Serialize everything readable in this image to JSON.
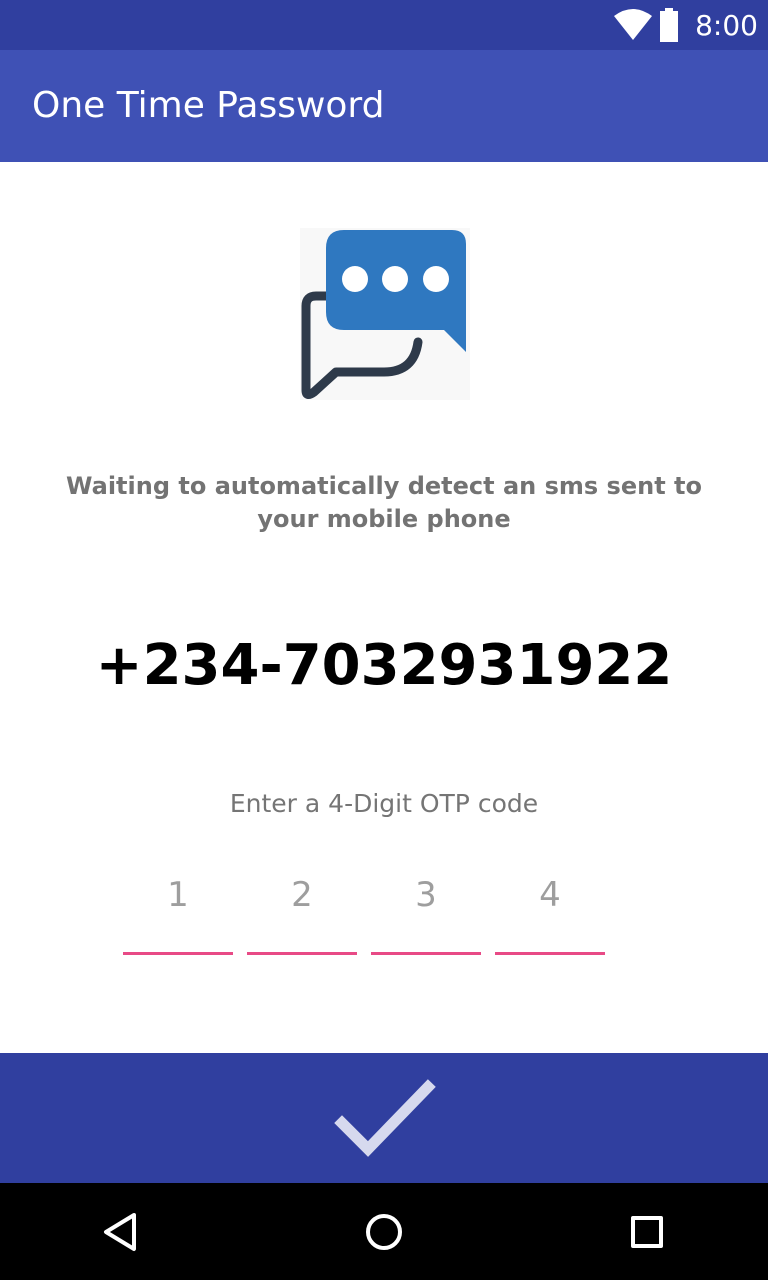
{
  "status_bar": {
    "time": "8:00",
    "icons": [
      "wifi-icon",
      "battery-icon"
    ],
    "background": "#303f9f"
  },
  "app_bar": {
    "title": "One Time Password",
    "background": "#3f51b5"
  },
  "main": {
    "illustration_icon": "chat-bubbles-icon",
    "waiting_text": "Waiting to automatically detect an sms sent to your mobile phone",
    "phone_number": "+234-7032931922",
    "otp_label": "Enter a 4-Digit OTP code",
    "otp_fields": [
      {
        "placeholder": "1"
      },
      {
        "placeholder": "2"
      },
      {
        "placeholder": "3"
      },
      {
        "placeholder": "4"
      }
    ],
    "underline_color": "#e84a86"
  },
  "submit": {
    "icon": "check-icon",
    "background": "#303f9f"
  },
  "nav_bar": {
    "icons": [
      "back-icon",
      "home-icon",
      "recents-icon"
    ]
  }
}
